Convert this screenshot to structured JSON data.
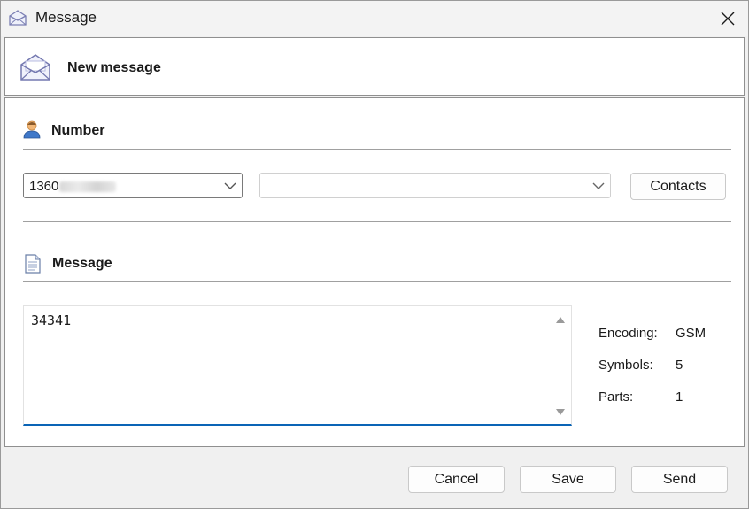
{
  "window": {
    "title": "Message"
  },
  "header": {
    "title": "New message"
  },
  "number_section": {
    "label": "Number",
    "number_value": "1360",
    "second_combo_value": "",
    "contacts_label": "Contacts"
  },
  "message_section": {
    "label": "Message",
    "text": "34341",
    "info": [
      {
        "label": "Encoding:",
        "value": "GSM"
      },
      {
        "label": "Symbols:",
        "value": "5"
      },
      {
        "label": "Parts:",
        "value": "1"
      }
    ]
  },
  "footer": {
    "cancel_label": "Cancel",
    "save_label": "Save",
    "send_label": "Send"
  },
  "icons": {
    "title": "envelope-icon",
    "header": "open-envelope-icon",
    "number": "person-icon",
    "message": "document-icon",
    "close": "close-icon",
    "dropdown": "chevron-down-icon"
  },
  "colors": {
    "accent": "#0a64b6",
    "panel_border": "#8f8f8f",
    "background": "#f0f0f0"
  }
}
